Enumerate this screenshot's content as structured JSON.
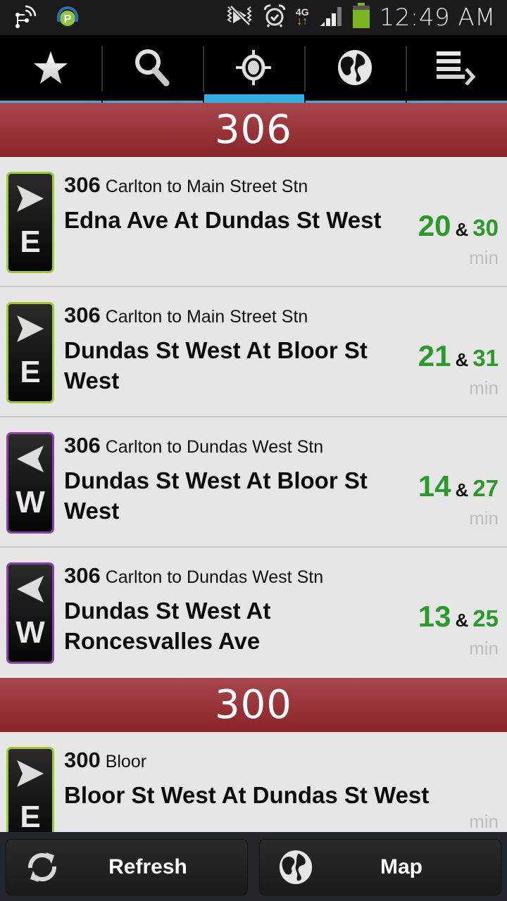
{
  "status_bar": {
    "time": "12:49 AM",
    "network": "4G",
    "icons": [
      "wifi-hotspot-icon",
      "podcast-app-icon",
      "mute-vibrate-icon",
      "alarm-icon",
      "network-4g-icon",
      "signal-icon",
      "battery-icon"
    ],
    "battery_color": "#7ab51d"
  },
  "tabs": [
    {
      "name": "favorites",
      "icon": "star-icon",
      "active": false
    },
    {
      "name": "search",
      "icon": "search-icon",
      "active": false
    },
    {
      "name": "nearby",
      "icon": "location-target-icon",
      "active": true
    },
    {
      "name": "map",
      "icon": "globe-icon",
      "active": false
    },
    {
      "name": "routes",
      "icon": "list-arrow-icon",
      "active": false
    }
  ],
  "accent_color": "#2eb0e4",
  "sections": [
    {
      "header": "306",
      "rows": [
        {
          "direction": "E",
          "route": "306",
          "destination": "Carlton to Main Street Stn",
          "stop": "Edna Ave At Dundas St West",
          "time1": "20",
          "amp": "&",
          "time2": "30",
          "unit": "min"
        },
        {
          "direction": "E",
          "route": "306",
          "destination": "Carlton to Main Street Stn",
          "stop": "Dundas St West At Bloor St West",
          "time1": "21",
          "amp": "&",
          "time2": "31",
          "unit": "min"
        },
        {
          "direction": "W",
          "route": "306",
          "destination": "Carlton to Dundas West Stn",
          "stop": "Dundas St West At Bloor St West",
          "time1": "14",
          "amp": "&",
          "time2": "27",
          "unit": "min"
        },
        {
          "direction": "W",
          "route": "306",
          "destination": "Carlton to Dundas West Stn",
          "stop": "Dundas St West At Roncesvalles Ave",
          "time1": "13",
          "amp": "&",
          "time2": "25",
          "unit": "min"
        }
      ]
    },
    {
      "header": "300",
      "rows": [
        {
          "direction": "E",
          "route": "300",
          "destination": "Bloor",
          "stop": "Bloor St West At Dundas St West",
          "unit": "min"
        }
      ]
    }
  ],
  "direction_colors": {
    "E": "#a3c72e",
    "W": "#8b3dab"
  },
  "bottom_bar": {
    "refresh_label": "Refresh",
    "map_label": "Map"
  }
}
